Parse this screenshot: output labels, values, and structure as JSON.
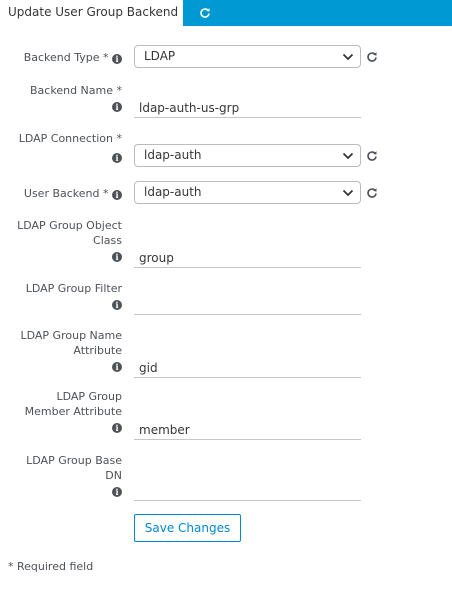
{
  "tabs": {
    "active_label": "Update User Group Backend",
    "refresh_icon": "refresh-icon"
  },
  "form": {
    "backend_type": {
      "label": "Backend Type *",
      "value": "LDAP"
    },
    "backend_name": {
      "label_line1": "Backend Name *",
      "value": "ldap-auth-us-grp"
    },
    "ldap_connection": {
      "label_line1": "LDAP Connection *",
      "value": "ldap-auth"
    },
    "user_backend": {
      "label": "User Backend *",
      "value": "ldap-auth"
    },
    "group_object_class": {
      "label_line1": "LDAP Group Object",
      "label_line2": "Class",
      "value": "group"
    },
    "group_filter": {
      "label_line1": "LDAP Group Filter",
      "value": ""
    },
    "group_name_attribute": {
      "label_line1": "LDAP Group Name",
      "label_line2": "Attribute",
      "value": "gid"
    },
    "group_member_attribute": {
      "label_line1": "LDAP Group",
      "label_line2": "Member Attribute",
      "value": "member"
    },
    "group_base_dn": {
      "label_line1": "LDAP Group Base",
      "label_line2": "DN",
      "value": ""
    },
    "save_label": "Save Changes",
    "required_note": "* Required field"
  },
  "colors": {
    "accent": "#0099d3",
    "button_text": "#0088ce"
  }
}
